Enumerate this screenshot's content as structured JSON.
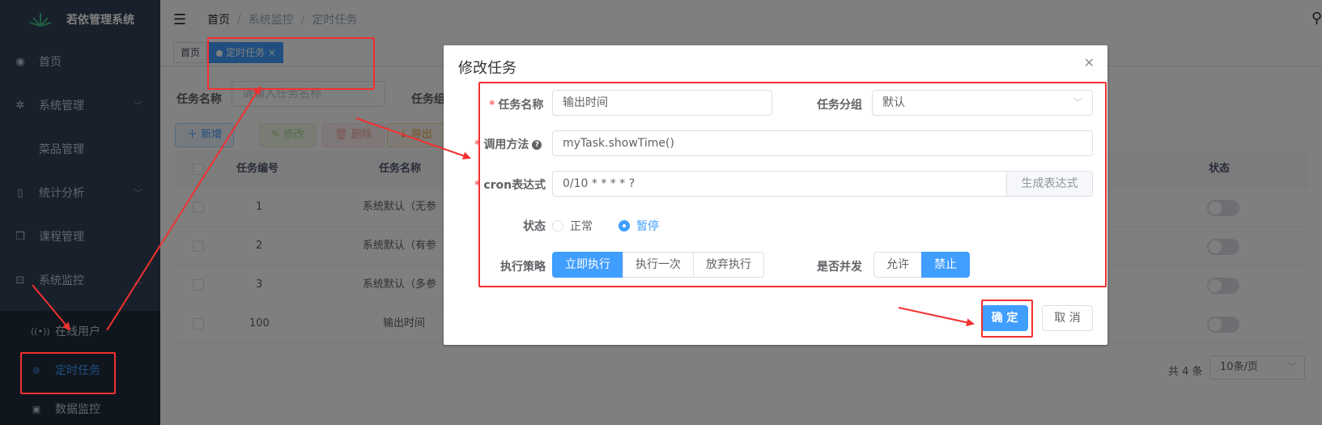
{
  "app": {
    "title": "若依管理系统"
  },
  "sidebar": {
    "items": [
      {
        "label": "首页",
        "icon": "dashboard-icon"
      },
      {
        "label": "系统管理",
        "icon": "gear-icon"
      },
      {
        "label": "菜品管理",
        "icon": ""
      },
      {
        "label": "统计分析",
        "icon": "phone-icon"
      },
      {
        "label": "课程管理",
        "icon": "copy-icon"
      },
      {
        "label": "系统监控",
        "icon": "monitor-icon"
      }
    ],
    "sub_items": [
      {
        "label": "在线用户",
        "icon": "online-icon"
      },
      {
        "label": "定时任务",
        "icon": "job-icon"
      },
      {
        "label": "数据监控",
        "icon": "druid-icon"
      }
    ]
  },
  "navbar": {
    "breadcrumb": [
      "首页",
      "系统监控",
      "定时任务"
    ],
    "separator": "/"
  },
  "tags": [
    {
      "label": "首页"
    },
    {
      "label": "定时任务",
      "close": "×"
    }
  ],
  "query": {
    "job_name_label": "任务名称",
    "job_name_placeholder": "请输入任务名称",
    "job_group_label": "任务组"
  },
  "toolbar": {
    "add": "新增",
    "edit": "修改",
    "delete": "删除",
    "export": "导出"
  },
  "table": {
    "columns": [
      "任务编号",
      "任务名称",
      "状态"
    ],
    "rows": [
      {
        "id": "1",
        "name": "系统默认（无参"
      },
      {
        "id": "2",
        "name": "系统默认（有参"
      },
      {
        "id": "3",
        "name": "系统默认（多参"
      },
      {
        "id": "100",
        "name": "输出时间"
      }
    ]
  },
  "pagination": {
    "total": "共 4 条",
    "page_size": "10条/页"
  },
  "dialog": {
    "title": "修改任务",
    "fields": {
      "job_name_label": "任务名称",
      "job_name_value": "输出时间",
      "job_group_label": "任务分组",
      "job_group_value": "默认",
      "invoke_label": "调用方法",
      "invoke_value": "myTask.showTime()",
      "cron_label": "cron表达式",
      "cron_value": "0/10 * * * * ?",
      "cron_generate": "生成表达式",
      "status_label": "状态",
      "status_options": [
        "正常",
        "暂停"
      ],
      "status_selected": "暂停",
      "misfire_label": "执行策略",
      "misfire_options": [
        "立即执行",
        "执行一次",
        "放弃执行"
      ],
      "misfire_selected": "立即执行",
      "concurrent_label": "是否并发",
      "concurrent_options": [
        "允许",
        "禁止"
      ],
      "concurrent_selected": "禁止",
      "required_mark": "*",
      "help_mark": "?"
    },
    "confirm": "确 定",
    "cancel": "取 消"
  },
  "colors": {
    "primary": "#409eff",
    "sidebar_bg": "#304156",
    "annotation_red": "#f23030"
  }
}
